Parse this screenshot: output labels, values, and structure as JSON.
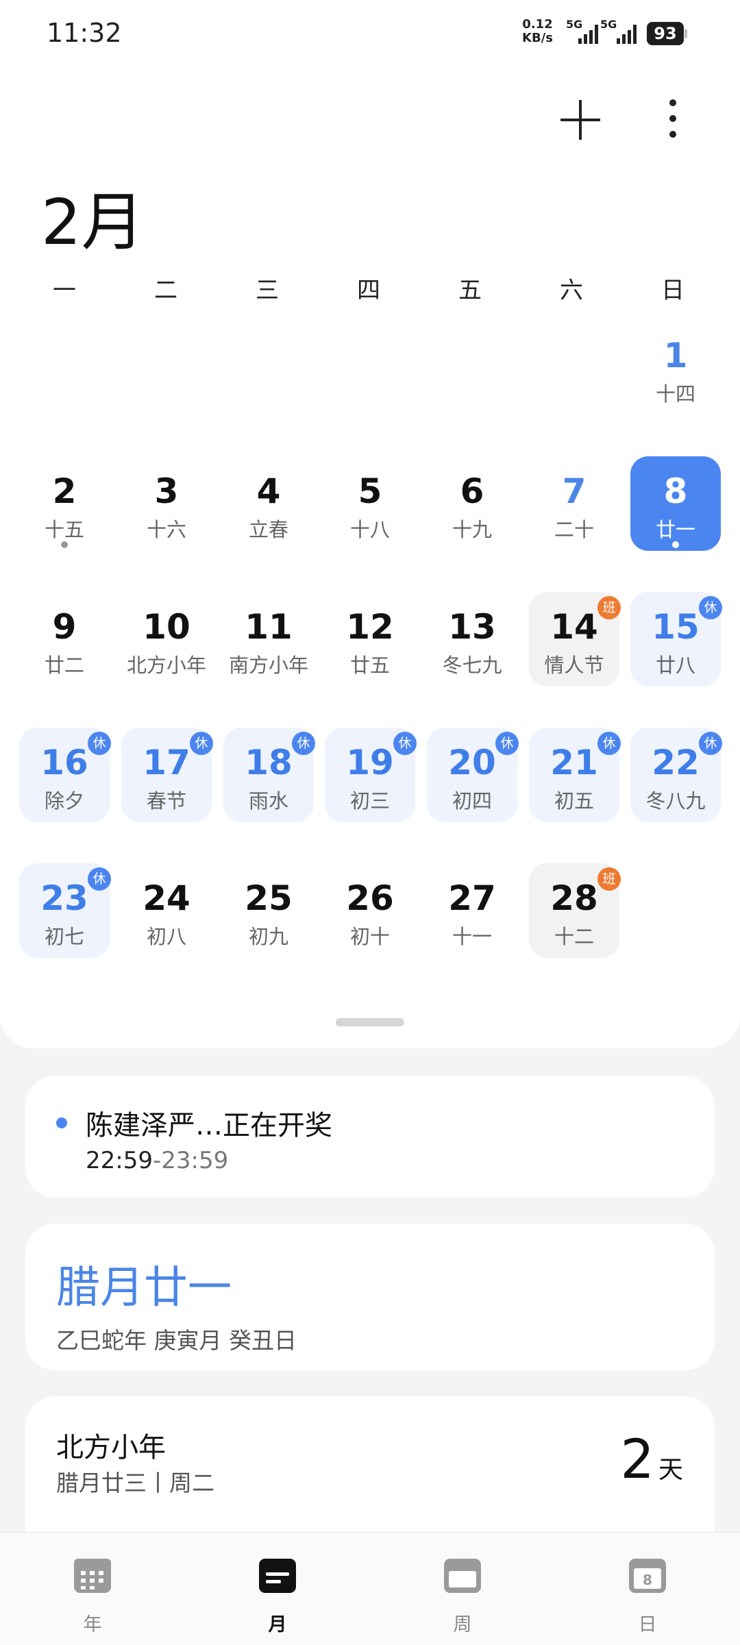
{
  "status": {
    "time": "11:32",
    "net_speed_value": "0.12",
    "net_speed_unit": "KB/s",
    "signal1": "5G",
    "signal2": "5G",
    "battery": "93"
  },
  "header": {
    "month_title": "2月",
    "add_icon": "plus-icon",
    "more_icon": "vertical-dots-icon"
  },
  "weekdays": [
    "一",
    "二",
    "三",
    "四",
    "五",
    "六",
    "日"
  ],
  "calendar": {
    "days": [
      {
        "num": "1",
        "lunar": "十四"
      },
      {
        "num": "2",
        "lunar": "十五"
      },
      {
        "num": "3",
        "lunar": "十六"
      },
      {
        "num": "4",
        "lunar": "立春"
      },
      {
        "num": "5",
        "lunar": "十八"
      },
      {
        "num": "6",
        "lunar": "十九"
      },
      {
        "num": "7",
        "lunar": "二十"
      },
      {
        "num": "8",
        "lunar": "廿一"
      },
      {
        "num": "9",
        "lunar": "廿二"
      },
      {
        "num": "10",
        "lunar": "北方小年"
      },
      {
        "num": "11",
        "lunar": "南方小年"
      },
      {
        "num": "12",
        "lunar": "廿五"
      },
      {
        "num": "13",
        "lunar": "冬七九"
      },
      {
        "num": "14",
        "lunar": "情人节",
        "badge": "班"
      },
      {
        "num": "15",
        "lunar": "廿八",
        "badge": "休"
      },
      {
        "num": "16",
        "lunar": "除夕",
        "badge": "休"
      },
      {
        "num": "17",
        "lunar": "春节",
        "badge": "休"
      },
      {
        "num": "18",
        "lunar": "雨水",
        "badge": "休"
      },
      {
        "num": "19",
        "lunar": "初三",
        "badge": "休"
      },
      {
        "num": "20",
        "lunar": "初四",
        "badge": "休"
      },
      {
        "num": "21",
        "lunar": "初五",
        "badge": "休"
      },
      {
        "num": "22",
        "lunar": "冬八九",
        "badge": "休"
      },
      {
        "num": "23",
        "lunar": "初七",
        "badge": "休"
      },
      {
        "num": "24",
        "lunar": "初八"
      },
      {
        "num": "25",
        "lunar": "初九"
      },
      {
        "num": "26",
        "lunar": "初十"
      },
      {
        "num": "27",
        "lunar": "十一"
      },
      {
        "num": "28",
        "lunar": "十二",
        "badge": "班"
      }
    ]
  },
  "event": {
    "title": "陈建泽严…正在开奖",
    "start": "22:59",
    "end": "-23:59"
  },
  "lunar_card": {
    "date": "腊月廿一",
    "ganzhi": "乙巳蛇年 庚寅月 癸丑日"
  },
  "festival": {
    "name": "北方小年",
    "sub": "腊月廿三丨周二",
    "count": "2",
    "unit": "天"
  },
  "nav": [
    {
      "label": "年",
      "icon": "year-grid-icon"
    },
    {
      "label": "月",
      "icon": "month-list-icon"
    },
    {
      "label": "周",
      "icon": "week-icon"
    },
    {
      "label": "日",
      "icon": "day-icon",
      "icon_text": "8"
    }
  ],
  "colors": {
    "accent": "#4b86f0",
    "work_badge": "#ef7a31",
    "holiday_bg": "#eef3fd"
  }
}
